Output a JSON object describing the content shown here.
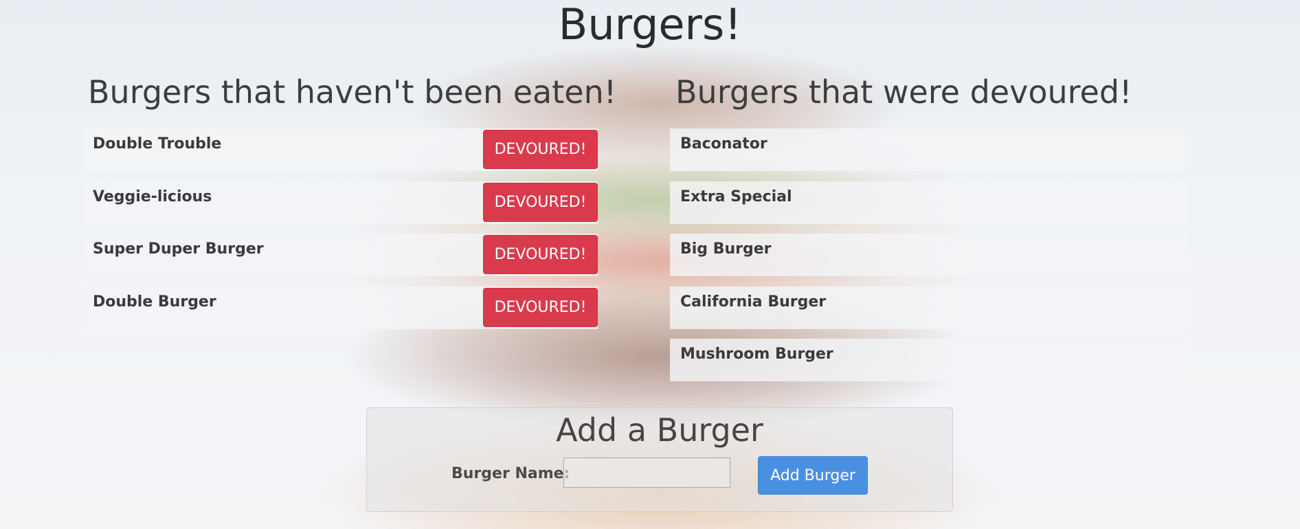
{
  "page": {
    "title": "Burgers!"
  },
  "uneaten": {
    "heading": "Burgers that haven't been eaten!",
    "button_label": "DEVOURED!",
    "items": [
      {
        "name": "Double Trouble"
      },
      {
        "name": "Veggie-licious"
      },
      {
        "name": "Super Duper Burger"
      },
      {
        "name": "Double Burger"
      }
    ]
  },
  "devoured": {
    "heading": "Burgers that were devoured!",
    "items": [
      {
        "name": "Baconator"
      },
      {
        "name": "Extra Special"
      },
      {
        "name": "Big Burger"
      },
      {
        "name": "California Burger"
      },
      {
        "name": "Mushroom Burger"
      }
    ]
  },
  "add_form": {
    "heading": "Add a Burger",
    "name_label": "Burger Name:",
    "name_value": "",
    "name_placeholder": "",
    "submit_label": "Add Burger"
  },
  "colors": {
    "devour_button": "#d93b4c",
    "add_button": "#4a90e2"
  }
}
